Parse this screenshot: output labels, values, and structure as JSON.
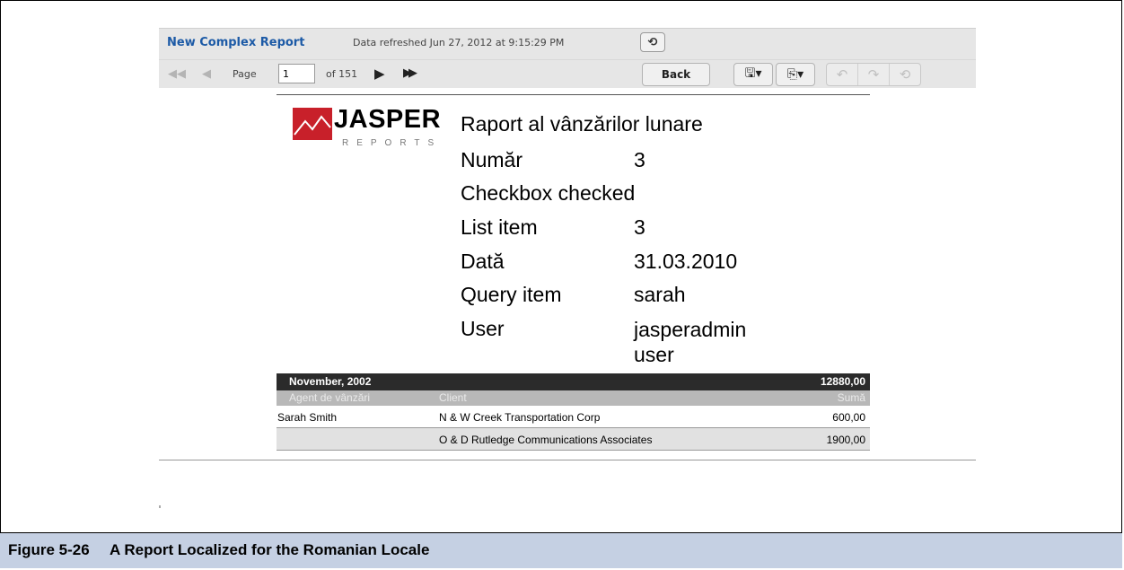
{
  "viewer": {
    "report_title": "New Complex Report",
    "refreshed": "Data refreshed Jun 27, 2012 at 9:15:29 PM",
    "page_label": "Page",
    "page_value": "1",
    "of_label": "of 151",
    "back_label": "Back",
    "icons": {
      "first": "first-page-icon",
      "prev": "previous-page-icon",
      "next": "next-page-icon",
      "last": "last-page-icon",
      "refresh": "refresh-icon",
      "save": "save-icon",
      "export": "export-icon",
      "undo": "undo-icon",
      "redo": "redo-icon",
      "undo_all": "undo-all-icon"
    }
  },
  "report": {
    "logo_word": "JASPER",
    "logo_sub": "REPORTS",
    "title": "Raport al vânzărilor lunare",
    "params": [
      {
        "label": "Număr",
        "value": "3"
      },
      {
        "label": "Checkbox checked",
        "value": ""
      },
      {
        "label": "List item",
        "value": "3"
      },
      {
        "label": "Dată",
        "value": "31.03.2010"
      },
      {
        "label": "Query item",
        "value": "sarah"
      },
      {
        "label": "User",
        "value": "jasperadmin\nuser"
      }
    ],
    "group": {
      "label": "November, 2002",
      "total": "12880,00"
    },
    "columns": {
      "agent": "Agent de vânzări",
      "client": "Client",
      "sum": "Sumă"
    },
    "rows": [
      {
        "agent": "Sarah Smith",
        "client": "N & W Creek Transportation Corp",
        "sum": "600,00"
      },
      {
        "agent": "",
        "client": "O & D Rutledge Communications Associates",
        "sum": "1900,00"
      }
    ]
  },
  "caption": {
    "number": "Figure 5-26",
    "text": "A Report Localized for the Romanian Locale"
  }
}
